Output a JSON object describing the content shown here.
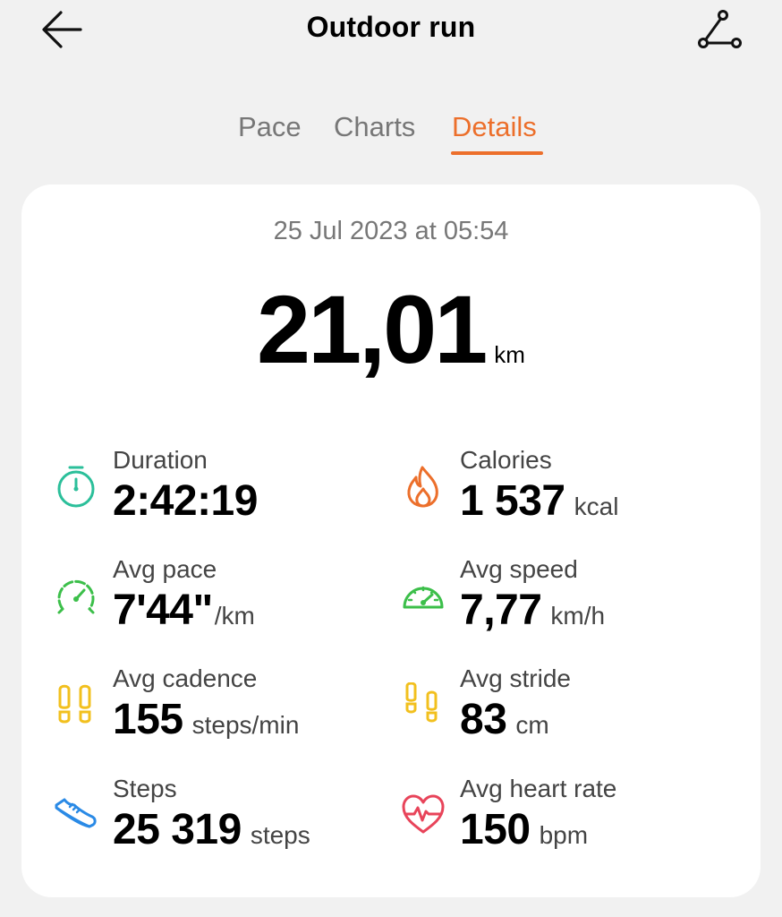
{
  "header": {
    "title": "Outdoor run",
    "back_icon": "arrow-left-icon",
    "route_icon": "route-icon"
  },
  "tabs": [
    {
      "label": "Pace",
      "active": false
    },
    {
      "label": "Charts",
      "active": false
    },
    {
      "label": "Details",
      "active": true
    }
  ],
  "summary": {
    "date": "25 Jul 2023 at 05:54",
    "distance": "21,01",
    "distance_unit": "km"
  },
  "metrics": {
    "duration": {
      "label": "Duration",
      "value": "2:42:19",
      "unit": "",
      "icon": "stopwatch-icon",
      "color": "#2bbf9a"
    },
    "calories": {
      "label": "Calories",
      "value": "1 537",
      "unit": "kcal",
      "icon": "flame-icon",
      "color": "#ec6f2b"
    },
    "avg_pace": {
      "label": "Avg pace",
      "value": "7'44\"",
      "unit": "/km",
      "icon": "pace-gauge-icon",
      "color": "#3cbf4a"
    },
    "avg_speed": {
      "label": "Avg speed",
      "value": "7,77",
      "unit": "km/h",
      "icon": "speedometer-icon",
      "color": "#3cbf4a"
    },
    "avg_cadence": {
      "label": "Avg cadence",
      "value": "155",
      "unit": "steps/min",
      "icon": "footprints-icon",
      "color": "#f2c01e"
    },
    "avg_stride": {
      "label": "Avg stride",
      "value": "83",
      "unit": "cm",
      "icon": "stride-footprints-icon",
      "color": "#f2c01e"
    },
    "steps": {
      "label": "Steps",
      "value": "25 319",
      "unit": "steps",
      "icon": "shoe-icon",
      "color": "#2a8ae6"
    },
    "avg_heart_rate": {
      "label": "Avg heart rate",
      "value": "150",
      "unit": "bpm",
      "icon": "heart-rate-icon",
      "color": "#e8445a"
    }
  },
  "colors": {
    "accent": "#ec6f2b",
    "background": "#f1f1f1",
    "card": "#ffffff"
  }
}
